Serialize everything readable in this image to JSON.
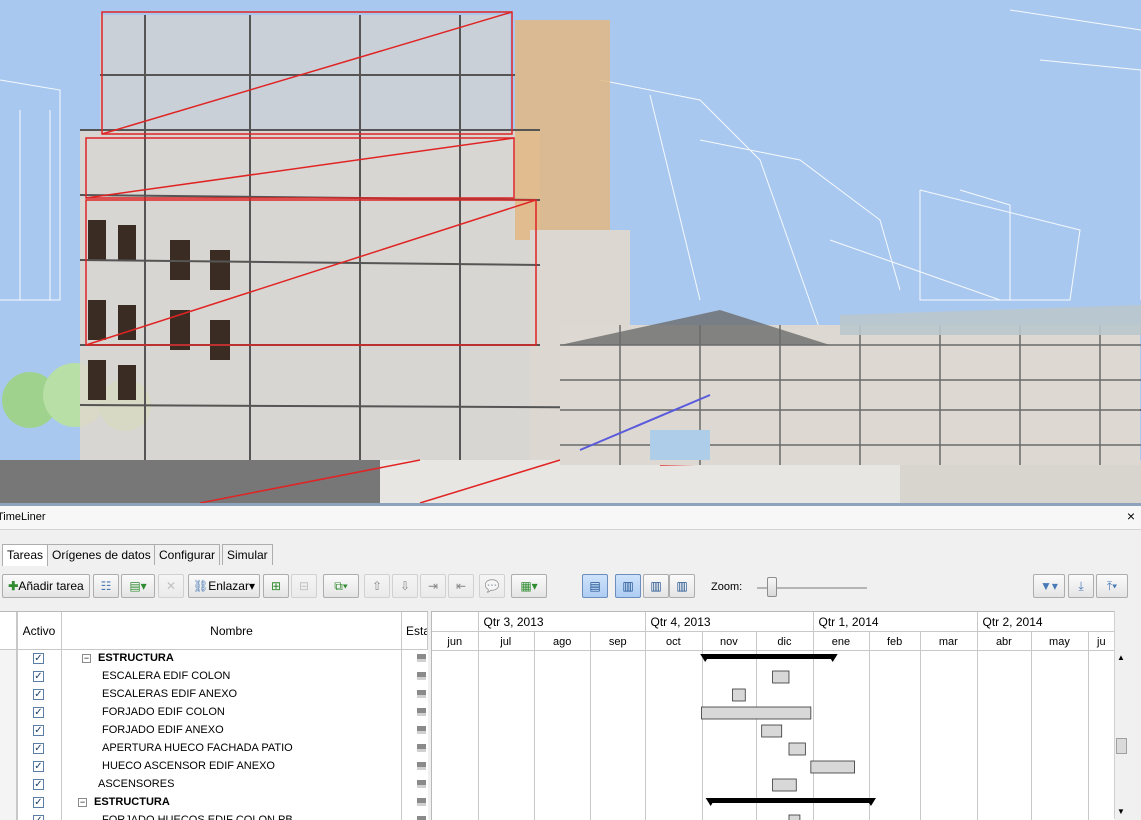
{
  "panel": {
    "title": "TimeLiner",
    "close_glyph": "×"
  },
  "tabs": [
    {
      "label": "Tareas",
      "active": true
    },
    {
      "label": "Orígenes de datos",
      "active": false
    },
    {
      "label": "Configurar",
      "active": false
    },
    {
      "label": "Simular",
      "active": false
    }
  ],
  "toolbar": {
    "add_task_label": "Añadir tarea",
    "link_label": "Enlazar",
    "zoom_label": "Zoom:",
    "zoom_level": 0.1
  },
  "grid": {
    "columns": {
      "active": "Activo",
      "name": "Nombre",
      "status": "Esta"
    },
    "rows": [
      {
        "name": "ESTRUCTURA",
        "bold": true,
        "expander": true,
        "indent": 1,
        "active": true,
        "bar": {
          "type": "summary",
          "start": "2013-11-03",
          "end": "2014-01-12"
        }
      },
      {
        "name": "ESCALERA EDIF COLON",
        "bold": false,
        "expander": false,
        "indent": 2,
        "active": true,
        "bar": {
          "type": "task",
          "start": "2013-12-10",
          "end": "2013-12-19"
        }
      },
      {
        "name": "ESCALERAS EDIF ANEXO",
        "bold": false,
        "expander": false,
        "indent": 2,
        "active": true,
        "bar": {
          "type": "task",
          "start": "2013-11-18",
          "end": "2013-11-25"
        }
      },
      {
        "name": "FORJADO EDIF COLON",
        "bold": false,
        "expander": false,
        "indent": 2,
        "active": true,
        "bar": {
          "type": "task",
          "start": "2013-11-01",
          "end": "2013-12-31"
        }
      },
      {
        "name": "FORJADO EDIF ANEXO",
        "bold": false,
        "expander": false,
        "indent": 2,
        "active": true,
        "bar": {
          "type": "task",
          "start": "2013-12-04",
          "end": "2013-12-15"
        }
      },
      {
        "name": "APERTURA HUECO FACHADA PATIO",
        "bold": false,
        "expander": false,
        "indent": 2,
        "active": true,
        "bar": {
          "type": "task",
          "start": "2013-12-19",
          "end": "2013-12-28"
        }
      },
      {
        "name": "HUECO ASCENSOR EDIF ANEXO",
        "bold": false,
        "expander": false,
        "indent": 2,
        "active": true,
        "bar": {
          "type": "task",
          "start": "2013-12-31",
          "end": "2014-01-24"
        }
      },
      {
        "name": "ASCENSORES",
        "bold": false,
        "expander": false,
        "indent": 1,
        "active": true,
        "bar": {
          "type": "task",
          "start": "2013-12-10",
          "end": "2013-12-23"
        }
      },
      {
        "name": "ESTRUCTURA",
        "bold": true,
        "expander": true,
        "indent": 0,
        "active": true,
        "bar": {
          "type": "summary",
          "start": "2013-11-06",
          "end": "2014-02-02"
        }
      },
      {
        "name": "FORJADO HUECOS EDIF COLON PB",
        "bold": false,
        "expander": false,
        "indent": 2,
        "active": true,
        "bar": {
          "type": "task",
          "start": "2013-12-19",
          "end": "2013-12-25"
        }
      }
    ]
  },
  "gantt": {
    "quarters": [
      {
        "label": "Qtr 3, 2013",
        "start": "2013-07-01"
      },
      {
        "label": "Qtr 4, 2013",
        "start": "2013-10-01"
      },
      {
        "label": "Qtr 1, 2014",
        "start": "2014-01-01"
      },
      {
        "label": "Qtr 2, 2014",
        "start": "2014-04-01"
      }
    ],
    "months": [
      {
        "label": "jun",
        "start": "2013-06-01"
      },
      {
        "label": "jul",
        "start": "2013-07-01"
      },
      {
        "label": "ago",
        "start": "2013-08-01"
      },
      {
        "label": "sep",
        "start": "2013-09-01"
      },
      {
        "label": "oct",
        "start": "2013-10-01"
      },
      {
        "label": "nov",
        "start": "2013-11-01"
      },
      {
        "label": "dic",
        "start": "2013-12-01"
      },
      {
        "label": "ene",
        "start": "2014-01-01"
      },
      {
        "label": "feb",
        "start": "2014-02-01"
      },
      {
        "label": "mar",
        "start": "2014-03-01"
      },
      {
        "label": "abr",
        "start": "2014-04-01"
      },
      {
        "label": "may",
        "start": "2014-05-01"
      },
      {
        "label": "ju",
        "start": "2014-06-01"
      }
    ],
    "range_start": "2013-06-06",
    "range_end": "2014-06-16"
  },
  "colors": {
    "sky": "#a9c8ef",
    "summary_bar": "#000000",
    "task_bar": "#d8d8d8",
    "task_border": "#333333",
    "accent": "#4a7ab5"
  }
}
